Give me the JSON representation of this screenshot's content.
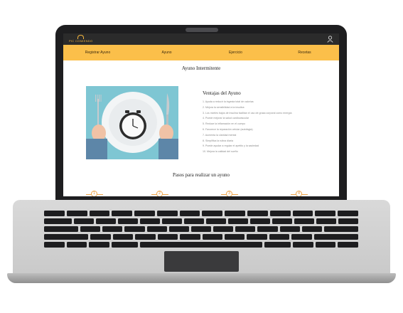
{
  "site": {
    "logo_text": "PIC COMIENDO",
    "nav": [
      "Registrar Ayuno",
      "Ayuno",
      "Ejercicio",
      "Recetas"
    ],
    "page_title": "Ayuno Intermitente",
    "benefits_title": "Ventajas del Ayuno",
    "benefits": [
      "1. Ayuda a reducir la ingesta total de calorías",
      "2. Mejora la sensibilidad a la insulina",
      "3. Los niveles bajos de insulina facilitan el uso de grasa corporal como energía",
      "4. Puede mejorar la salud cardiovascular",
      "5. Reduce la inflamación en el cuerpo",
      "6. Favorece la reparación celular (autofagia)",
      "7. Aumenta la claridad mental",
      "8. Simplifica la rutina diaria",
      "9. Puede ayudar a regular el apetito y la saciedad",
      "10. Mejora la calidad del sueño"
    ],
    "steps_title": "Pasos para realizar un ayuno",
    "steps": [
      "1",
      "2",
      "3",
      "4"
    ]
  },
  "colors": {
    "nav_bg": "#fbbf4a",
    "topbar_bg": "#2b2b2b",
    "accent": "#f0a64a",
    "hero_bg": "#7ec6d3"
  }
}
